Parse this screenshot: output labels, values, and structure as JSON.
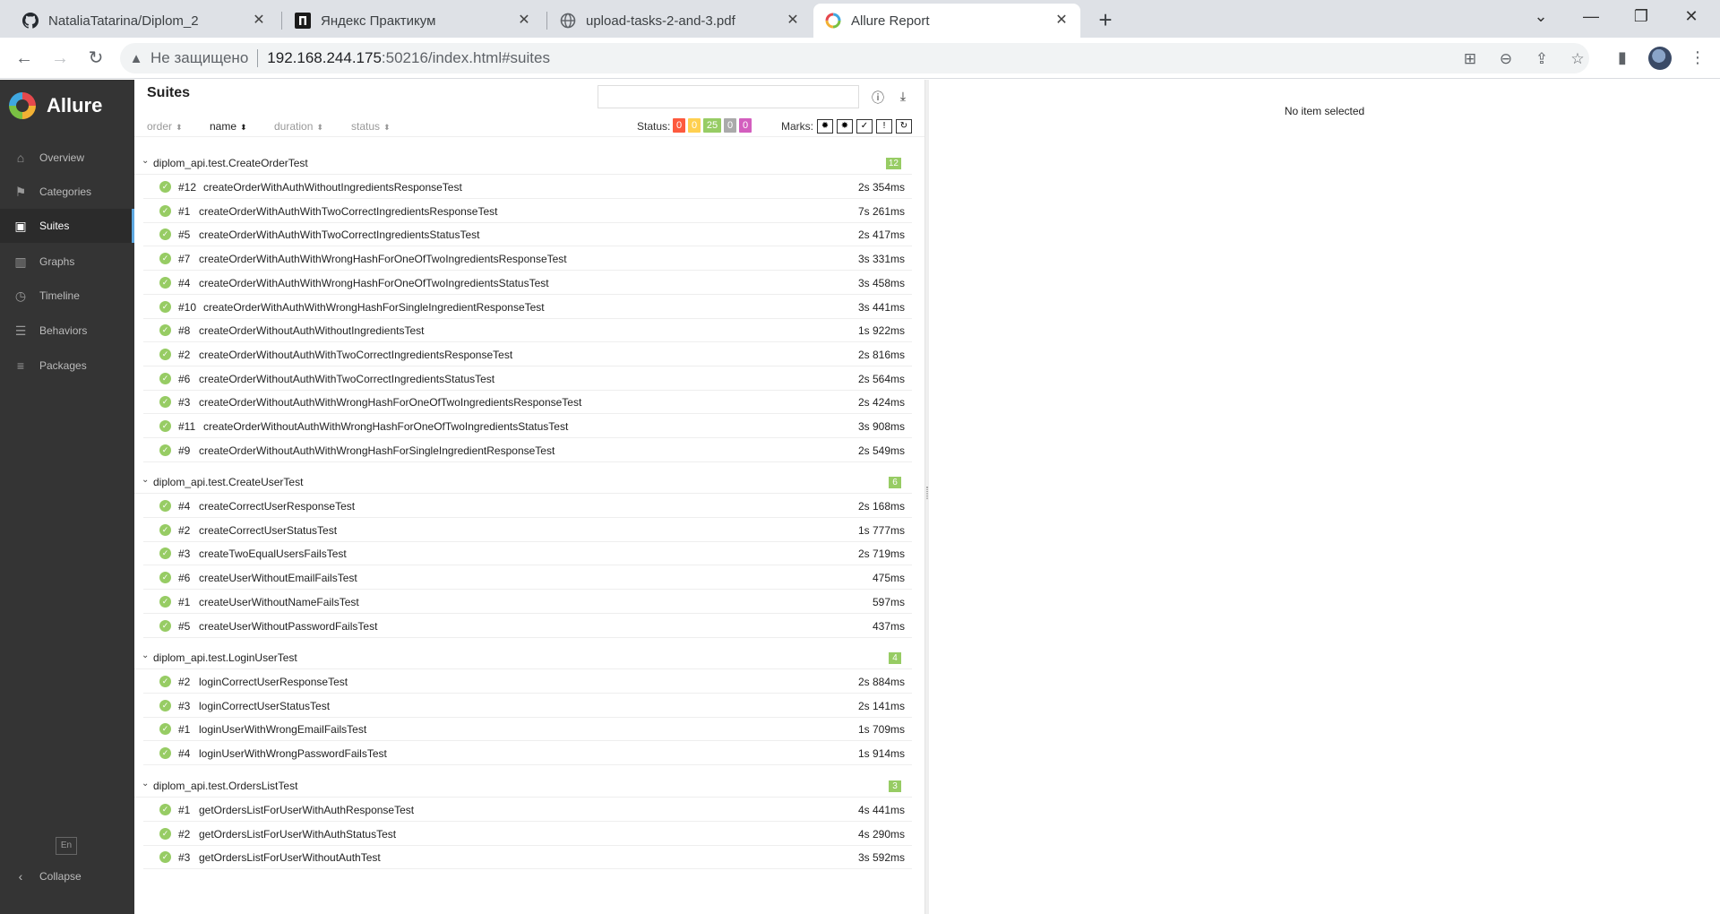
{
  "browser": {
    "tabs": [
      {
        "title": "NataliaTatarina/Diplom_2",
        "icon": "github-icon"
      },
      {
        "title": "Яндекс Практикум",
        "icon": "practicum-icon"
      },
      {
        "title": "upload-tasks-2-and-3.pdf",
        "icon": "globe-icon"
      },
      {
        "title": "Allure Report",
        "icon": "allure-icon",
        "active": true
      }
    ],
    "security_text": "Не защищено",
    "url_host": "192.168.244.175",
    "url_rest": ":50216/index.html#suites"
  },
  "sidebar": {
    "brand": "Allure",
    "items": [
      {
        "label": "Overview",
        "icon": "home-icon"
      },
      {
        "label": "Categories",
        "icon": "flag-icon"
      },
      {
        "label": "Suites",
        "icon": "briefcase-icon",
        "active": true
      },
      {
        "label": "Graphs",
        "icon": "bar-chart-icon"
      },
      {
        "label": "Timeline",
        "icon": "clock-icon"
      },
      {
        "label": "Behaviors",
        "icon": "list-icon"
      },
      {
        "label": "Packages",
        "icon": "align-left-icon"
      }
    ],
    "language": "En",
    "collapse": "Collapse"
  },
  "suites": {
    "title": "Suites",
    "sort": {
      "order": "order",
      "name": "name",
      "duration": "duration",
      "status": "status"
    },
    "status_label": "Status:",
    "status_counts": [
      {
        "value": "0",
        "color": "#fd5a3e"
      },
      {
        "value": "0",
        "color": "#ffd050"
      },
      {
        "value": "25",
        "color": "#97cc64"
      },
      {
        "value": "0",
        "color": "#aaaaaa"
      },
      {
        "value": "0",
        "color": "#d35ebe"
      }
    ],
    "marks_label": "Marks:",
    "groups": [
      {
        "name": "diplom_api.test.CreateOrderTest",
        "count": "12",
        "tests": [
          {
            "num": "#12",
            "name": "createOrderWithAuthWithoutIngredientsResponseTest",
            "duration": "2s 354ms"
          },
          {
            "num": "#1",
            "name": "createOrderWithAuthWithTwoCorrectIngredientsResponseTest",
            "duration": "7s 261ms"
          },
          {
            "num": "#5",
            "name": "createOrderWithAuthWithTwoCorrectIngredientsStatusTest",
            "duration": "2s 417ms"
          },
          {
            "num": "#7",
            "name": "createOrderWithAuthWithWrongHashForOneOfTwoIngredientsResponseTest",
            "duration": "3s 331ms"
          },
          {
            "num": "#4",
            "name": "createOrderWithAuthWithWrongHashForOneOfTwoIngredientsStatusTest",
            "duration": "3s 458ms"
          },
          {
            "num": "#10",
            "name": "createOrderWithAuthWithWrongHashForSingleIngredientResponseTest",
            "duration": "3s 441ms"
          },
          {
            "num": "#8",
            "name": "createOrderWithoutAuthWithoutIngredientsTest",
            "duration": "1s 922ms"
          },
          {
            "num": "#2",
            "name": "createOrderWithoutAuthWithTwoCorrectIngredientsResponseTest",
            "duration": "2s 816ms"
          },
          {
            "num": "#6",
            "name": "createOrderWithoutAuthWithTwoCorrectIngredientsStatusTest",
            "duration": "2s 564ms"
          },
          {
            "num": "#3",
            "name": "createOrderWithoutAuthWithWrongHashForOneOfTwoIngredientsResponseTest",
            "duration": "2s 424ms"
          },
          {
            "num": "#11",
            "name": "createOrderWithoutAuthWithWrongHashForOneOfTwoIngredientsStatusTest",
            "duration": "3s 908ms"
          },
          {
            "num": "#9",
            "name": "createOrderWithoutAuthWithWrongHashForSingleIngredientResponseTest",
            "duration": "2s 549ms"
          }
        ]
      },
      {
        "name": "diplom_api.test.CreateUserTest",
        "count": "6",
        "tests": [
          {
            "num": "#4",
            "name": "createCorrectUserResponseTest",
            "duration": "2s 168ms"
          },
          {
            "num": "#2",
            "name": "createCorrectUserStatusTest",
            "duration": "1s 777ms"
          },
          {
            "num": "#3",
            "name": "createTwoEqualUsersFailsTest",
            "duration": "2s 719ms"
          },
          {
            "num": "#6",
            "name": "createUserWithoutEmailFailsTest",
            "duration": "475ms"
          },
          {
            "num": "#1",
            "name": "createUserWithoutNameFailsTest",
            "duration": "597ms"
          },
          {
            "num": "#5",
            "name": "createUserWithoutPasswordFailsTest",
            "duration": "437ms"
          }
        ]
      },
      {
        "name": "diplom_api.test.LoginUserTest",
        "count": "4",
        "tests": [
          {
            "num": "#2",
            "name": "loginCorrectUserResponseTest",
            "duration": "2s 884ms"
          },
          {
            "num": "#3",
            "name": "loginCorrectUserStatusTest",
            "duration": "2s 141ms"
          },
          {
            "num": "#1",
            "name": "loginUserWithWrongEmailFailsTest",
            "duration": "1s 709ms"
          },
          {
            "num": "#4",
            "name": "loginUserWithWrongPasswordFailsTest",
            "duration": "1s 914ms"
          }
        ]
      },
      {
        "name": "diplom_api.test.OrdersListTest",
        "count": "3",
        "tests": [
          {
            "num": "#1",
            "name": "getOrdersListForUserWithAuthResponseTest",
            "duration": "4s 441ms"
          },
          {
            "num": "#2",
            "name": "getOrdersListForUserWithAuthStatusTest",
            "duration": "4s 290ms"
          },
          {
            "num": "#3",
            "name": "getOrdersListForUserWithoutAuthTest",
            "duration": "3s 592ms"
          }
        ]
      }
    ]
  },
  "detail": {
    "empty_text": "No item selected"
  }
}
